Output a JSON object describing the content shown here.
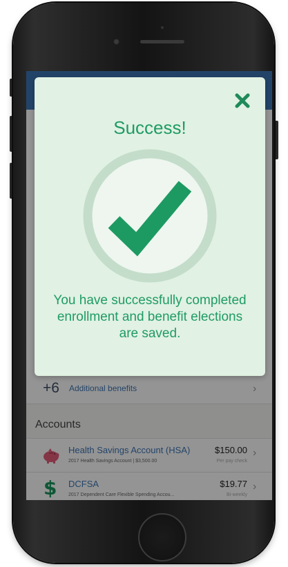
{
  "modal": {
    "title": "Success!",
    "message": "You have successfully completed enrollment and benefit elections are saved."
  },
  "benefits": {
    "count": "+6",
    "label": "Additional benefits"
  },
  "accounts": {
    "heading": "Accounts",
    "items": [
      {
        "name": "Health Savings Account (HSA)",
        "subtitle": "2017 Health Savings Account | $3,500.00",
        "amount": "$150.00",
        "frequency": "Per pay check",
        "icon": "piggy-bank-icon"
      },
      {
        "name": "DCFSA",
        "subtitle": "2017 Dependent Care Flexible Spending Accou...",
        "amount": "$19.77",
        "frequency": "Bi-weekly",
        "icon": "dollar-icon"
      }
    ]
  },
  "icons": {
    "close": "close-icon",
    "checkmark": "checkmark-icon",
    "chevron": "chevron-right-icon"
  },
  "colors": {
    "header": "#3d76b5",
    "success_green": "#1f9b65",
    "modal_bg": "#e1f1e3",
    "link_blue": "#3d76b5"
  }
}
